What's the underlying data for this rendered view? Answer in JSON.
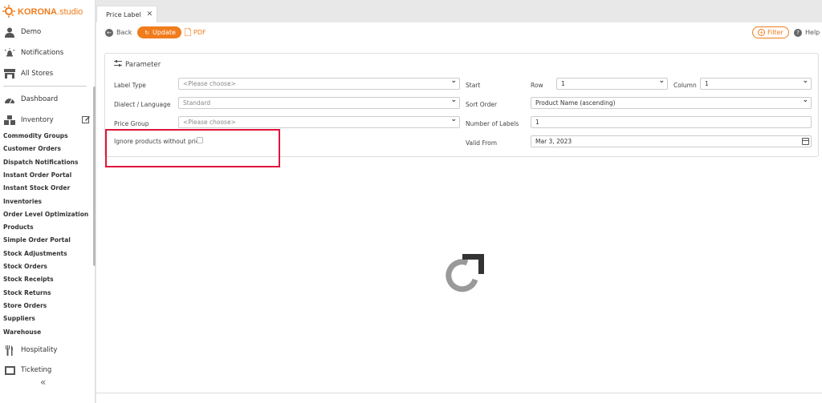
{
  "brand": {
    "logo_bold": "KORONA",
    "logo_light": ".studio",
    "color": "#f07c1c"
  },
  "sidebar": {
    "top_items": [
      {
        "label": "Demo",
        "icon": "user-icon"
      },
      {
        "label": "Notifications",
        "icon": "bell-icon"
      },
      {
        "label": "All Stores",
        "icon": "store-icon"
      }
    ],
    "section_items": [
      {
        "label": "Dashboard",
        "icon": "dashboard-icon"
      },
      {
        "label": "Inventory",
        "icon": "boxes-icon",
        "edit_icon": "edit-icon"
      }
    ],
    "inventory_items": [
      "Commodity Groups",
      "Customer Orders",
      "Dispatch Notifications",
      "Instant Order Portal",
      "Instant Stock Order",
      "Inventories",
      "Order Level Optimization",
      "Products",
      "Simple Order Portal",
      "Stock Adjustments",
      "Stock Orders",
      "Stock Receipts",
      "Stock Returns",
      "Store Orders",
      "Suppliers",
      "Warehouse"
    ],
    "bottom_items": [
      {
        "label": "Hospitality",
        "icon": "cutlery-icon"
      },
      {
        "label": "Ticketing",
        "icon": "ticket-icon"
      }
    ],
    "collapse_icon": "double-chevron-left-icon"
  },
  "tab": {
    "label": "Price Label",
    "close_icon": "close-icon"
  },
  "toolbar": {
    "back_label": "Back",
    "update_label": "Update",
    "pdf_label": "PDF",
    "filter_label": "Filter",
    "help_label": "Help"
  },
  "panel": {
    "title": "Parameter",
    "label_type_label": "Label Type",
    "label_type_value": "<Please choose>",
    "dialect_label": "Dialect / Language",
    "dialect_value": "Standard",
    "price_group_label": "Price Group",
    "price_group_value": "<Please choose>",
    "ignore_label": "Ignore products without price",
    "ignore_checked": false,
    "start_label": "Start",
    "row_label": "Row",
    "row_value": "1",
    "column_label": "Column",
    "column_value": "1",
    "sort_label": "Sort Order",
    "sort_value": "Product Name (ascending)",
    "num_labels_label": "Number of Labels",
    "num_labels_value": "1",
    "valid_from_label": "Valid From",
    "valid_from_value": "Mar 3, 2023"
  },
  "colors": {
    "accent": "#f07c1c",
    "highlight": "#e0143c",
    "spinner_gray": "#999999",
    "spinner_dark": "#333333"
  }
}
